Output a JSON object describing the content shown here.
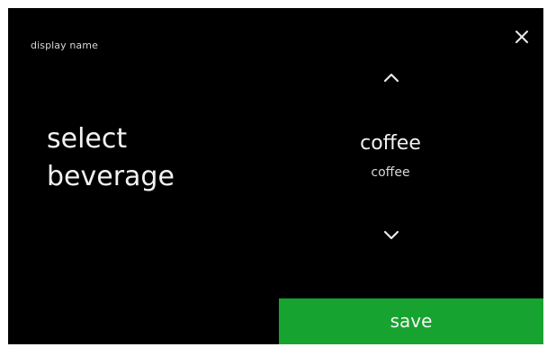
{
  "header": {
    "label": "display name"
  },
  "main": {
    "title_line1": "select",
    "title_line2": "beverage"
  },
  "picker": {
    "selected_value": "coffee",
    "selected_sub": "coffee"
  },
  "actions": {
    "save_label": "save"
  },
  "icons": {
    "close": "close-icon",
    "up": "chevron-up-icon",
    "down": "chevron-down-icon"
  },
  "colors": {
    "background": "#000000",
    "text": "#f2f2f2",
    "accent": "#17a32f"
  }
}
